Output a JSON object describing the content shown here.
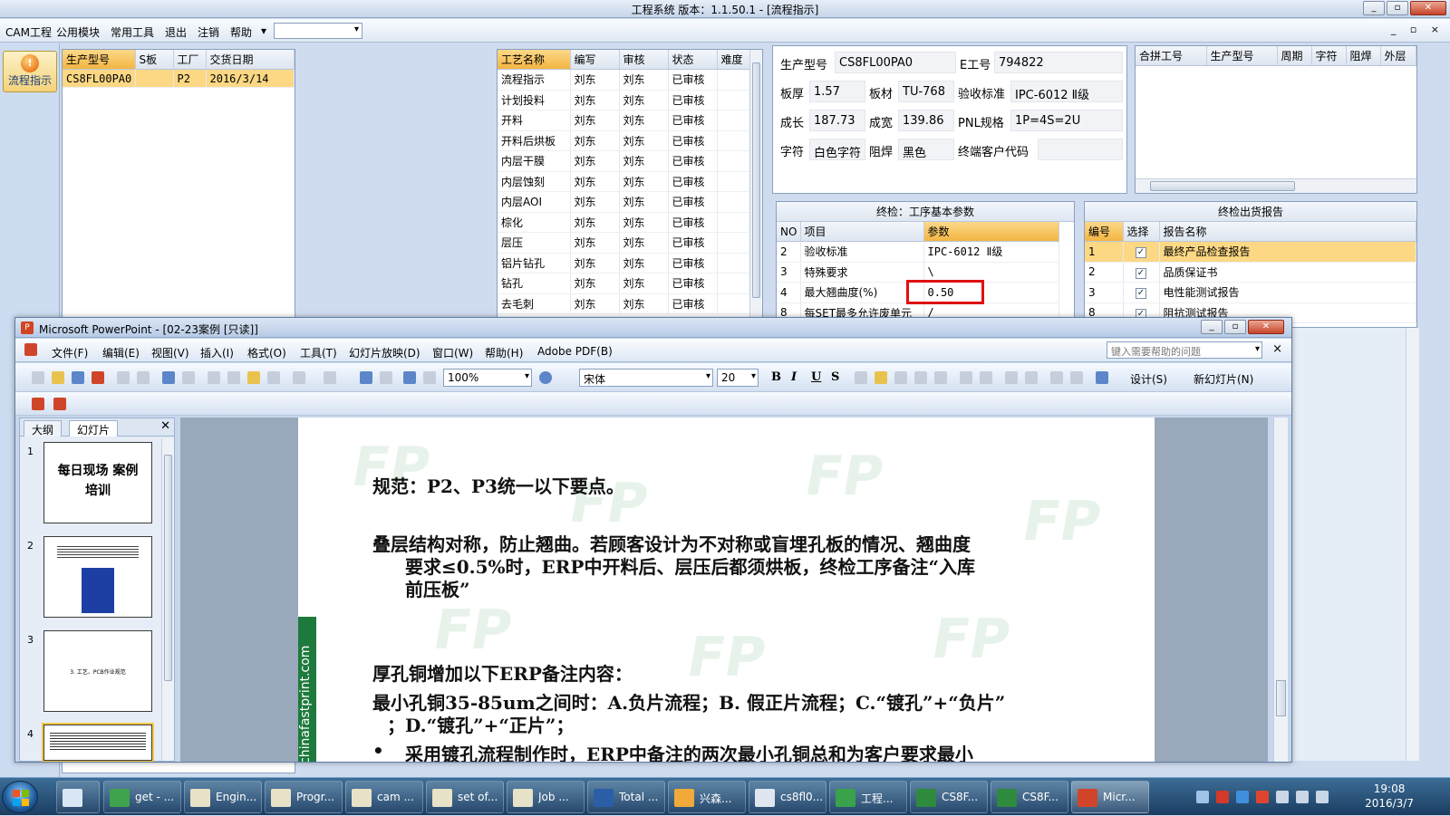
{
  "app": {
    "title": "工程系统   版本：1.1.50.1 - [流程指示]",
    "menu": [
      "CAM工程",
      "公用模块",
      "常用工具",
      "退出",
      "注销",
      "帮助"
    ],
    "help_arrow": "▾",
    "right_buttons": "_ ▫ ×"
  },
  "leftbar": {
    "flow_label": "流程指示"
  },
  "order_table": {
    "headers": [
      "生产型号",
      "S板",
      "工厂",
      "交货日期"
    ],
    "rows": [
      [
        "CS8FL00PA0",
        "",
        "P2",
        "2016/3/14"
      ]
    ]
  },
  "process_table": {
    "headers": [
      "工艺名称",
      "编写",
      "审核",
      "状态",
      "难度"
    ],
    "rows": [
      [
        "流程指示",
        "刘东",
        "刘东",
        "已审核",
        ""
      ],
      [
        "计划投料",
        "刘东",
        "刘东",
        "已审核",
        ""
      ],
      [
        "开料",
        "刘东",
        "刘东",
        "已审核",
        ""
      ],
      [
        "开料后烘板",
        "刘东",
        "刘东",
        "已审核",
        ""
      ],
      [
        "内层干膜",
        "刘东",
        "刘东",
        "已审核",
        ""
      ],
      [
        "内层蚀刻",
        "刘东",
        "刘东",
        "已审核",
        ""
      ],
      [
        "内层AOI",
        "刘东",
        "刘东",
        "已审核",
        ""
      ],
      [
        "棕化",
        "刘东",
        "刘东",
        "已审核",
        ""
      ],
      [
        "层压",
        "刘东",
        "刘东",
        "已审核",
        ""
      ],
      [
        "铝片钻孔",
        "刘东",
        "刘东",
        "已审核",
        ""
      ],
      [
        "钻孔",
        "刘东",
        "刘东",
        "已审核",
        ""
      ],
      [
        "去毛刺",
        "刘东",
        "刘东",
        "已审核",
        ""
      ]
    ]
  },
  "info": {
    "prod_model_label": "生产型号",
    "prod_model": "CS8FL00PA0",
    "e_no_label": "E工号",
    "e_no": "794822",
    "thickness_label": "板厚",
    "thickness": "1.57",
    "material_label": "板材",
    "material": "TU-768",
    "accept_label": "验收标准",
    "accept": "IPC-6012 Ⅱ级",
    "length_label": "成长",
    "length": "187.73",
    "width_label": "成宽",
    "width": "139.86",
    "pnl_label": "PNL规格",
    "pnl": "1P=4S=2U",
    "char_label": "字符",
    "char": "白色字符",
    "mask_label": "阻焊",
    "mask": "黑色",
    "cust_label": "终端客户代码",
    "cust": ""
  },
  "merge_table": {
    "headers": [
      "合拼工号",
      "生产型号",
      "周期",
      "字符",
      "阻焊",
      "外层"
    ]
  },
  "final_check": {
    "title": "终检：工序基本参数",
    "headers": [
      "NO",
      "项目",
      "参数"
    ],
    "rows": [
      [
        "2",
        "验收标准",
        "IPC-6012 Ⅱ级"
      ],
      [
        "3",
        "特殊要求",
        "\\"
      ],
      [
        "4",
        "最大翘曲度(%)",
        "0.50"
      ],
      [
        "8",
        "每SET最多允许废单元",
        "/"
      ]
    ]
  },
  "report": {
    "title": "终检出货报告",
    "headers": [
      "编号",
      "选择",
      "报告名称"
    ],
    "check_mark": "✓",
    "rows": [
      [
        "1",
        "最终产品检查报告"
      ],
      [
        "2",
        "品质保证书"
      ],
      [
        "3",
        "电性能测试报告"
      ],
      [
        "8",
        "阻抗测试报告"
      ]
    ]
  },
  "ppt": {
    "title": "Microsoft PowerPoint - [02-23案例 [只读]]",
    "menu": [
      "文件(F)",
      "编辑(E)",
      "视图(V)",
      "插入(I)",
      "格式(O)",
      "工具(T)",
      "幻灯片放映(D)",
      "窗口(W)",
      "帮助(H)",
      "Adobe PDF(B)"
    ],
    "help_placeholder": "键入需要帮助的问题",
    "close": "×",
    "zoom": "100%",
    "font": "宋体",
    "font_size": "20",
    "bold": "B",
    "italic": "I",
    "underline": "U",
    "shadow": "S",
    "design": "设计(S)",
    "new_slide": "新幻灯片(N)",
    "tab_outline": "大纲",
    "tab_slides": "幻灯片",
    "thumb1_title": "每日现场 案例培训",
    "thumb3_text": "3. 工艺、PCB作业规范",
    "thumb_nums": [
      "1",
      "2",
      "3",
      "4"
    ],
    "side_text": "chinafastprint.com",
    "slide_lines": [
      "规范：P2、P3统一以下要点。",
      "叠层结构对称，防止翘曲。若顾客设计为不对称或盲埋孔板的情况、翘曲度",
      "要求≤0.5%时，ERP中开料后、层压后都须烘板，终检工序备注“入库",
      "前压板”",
      "厚孔铜增加以下ERP备注内容：",
      "最小孔铜35-85um之间时：A.负片流程；B. 假正片流程；C.“镀孔”+“负片”",
      "；D.“镀孔”+“正片”；",
      "•",
      "采用镀孔流程制作时，ERP中备注的两次最小孔铜总和为客户要求最小"
    ]
  },
  "taskbar": {
    "tasks": [
      "get - ...",
      "Engin...",
      "Progr...",
      "cam ...",
      "set of...",
      "Job ...",
      "Total ...",
      "兴森...",
      "cs8fl0...",
      "工程...",
      "CS8F...",
      "CS8F...",
      "Micr..."
    ],
    "time": "19:08",
    "date": "2016/3/7"
  },
  "colors": {
    "selected_row": "#fcd884",
    "highlight_box": "#e01010",
    "taskbar": "#1b3d62"
  }
}
